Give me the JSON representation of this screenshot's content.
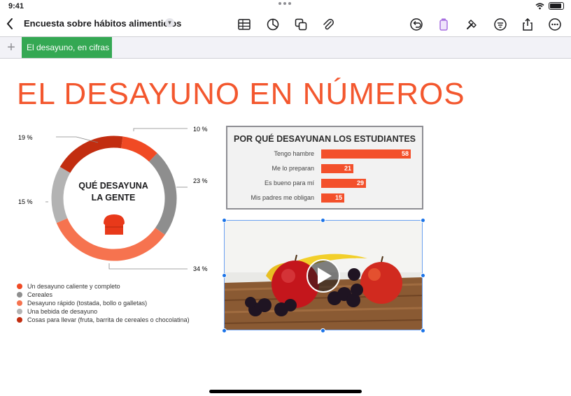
{
  "status": {
    "time": "9:41"
  },
  "toolbar": {
    "doc_title": "Encuesta sobre hábitos alimenticios"
  },
  "sheets": [
    {
      "label": "El desayuno, en cifras",
      "active": true
    }
  ],
  "slide": {
    "title": "EL DESAYUNO EN NÚMEROS",
    "accent": "#f3572e"
  },
  "donut": {
    "center_lines": [
      "QUÉ DESAYUNA",
      "LA GENTE"
    ],
    "callouts": [
      "10 %",
      "23 %",
      "34 %",
      "15 %",
      "19 %"
    ],
    "legend": [
      {
        "label": "Un desayuno caliente y completo",
        "color": "#f04a24"
      },
      {
        "label": "Cereales",
        "color": "#8e8e8e"
      },
      {
        "label": "Desayuno rápido (tostada, bollo o galletas)",
        "color": "#f6734f"
      },
      {
        "label": "Una bebida de desayuno",
        "color": "#b3b3b3"
      },
      {
        "label": "Cosas para llevar (fruta, barrita de cereales o chocolatina)",
        "color": "#c22d10"
      }
    ]
  },
  "chart_data": [
    {
      "type": "pie",
      "title": "QUÉ DESAYUNA LA GENTE",
      "categories": [
        "Un desayuno caliente y completo",
        "Cereales",
        "Desayuno rápido (tostada, bollo o galletas)",
        "Una bebida de desayuno",
        "Cosas para llevar (fruta, barrita de cereales o chocolatina)"
      ],
      "values": [
        10,
        23,
        34,
        15,
        19
      ],
      "colors": [
        "#f04a24",
        "#8e8e8e",
        "#f6734f",
        "#b3b3b3",
        "#c22d10"
      ]
    },
    {
      "type": "bar",
      "title": "POR QUÉ DESAYUNAN LOS ESTUDIANTES",
      "categories": [
        "Tengo hambre",
        "Me lo preparan",
        "Es bueno para mí",
        "Mis padres me obligan"
      ],
      "values": [
        58,
        21,
        29,
        15
      ],
      "value_labels": [
        "58",
        "21",
        "29",
        "15"
      ],
      "orientation": "horizontal",
      "bar_color": "#f3502b"
    }
  ]
}
